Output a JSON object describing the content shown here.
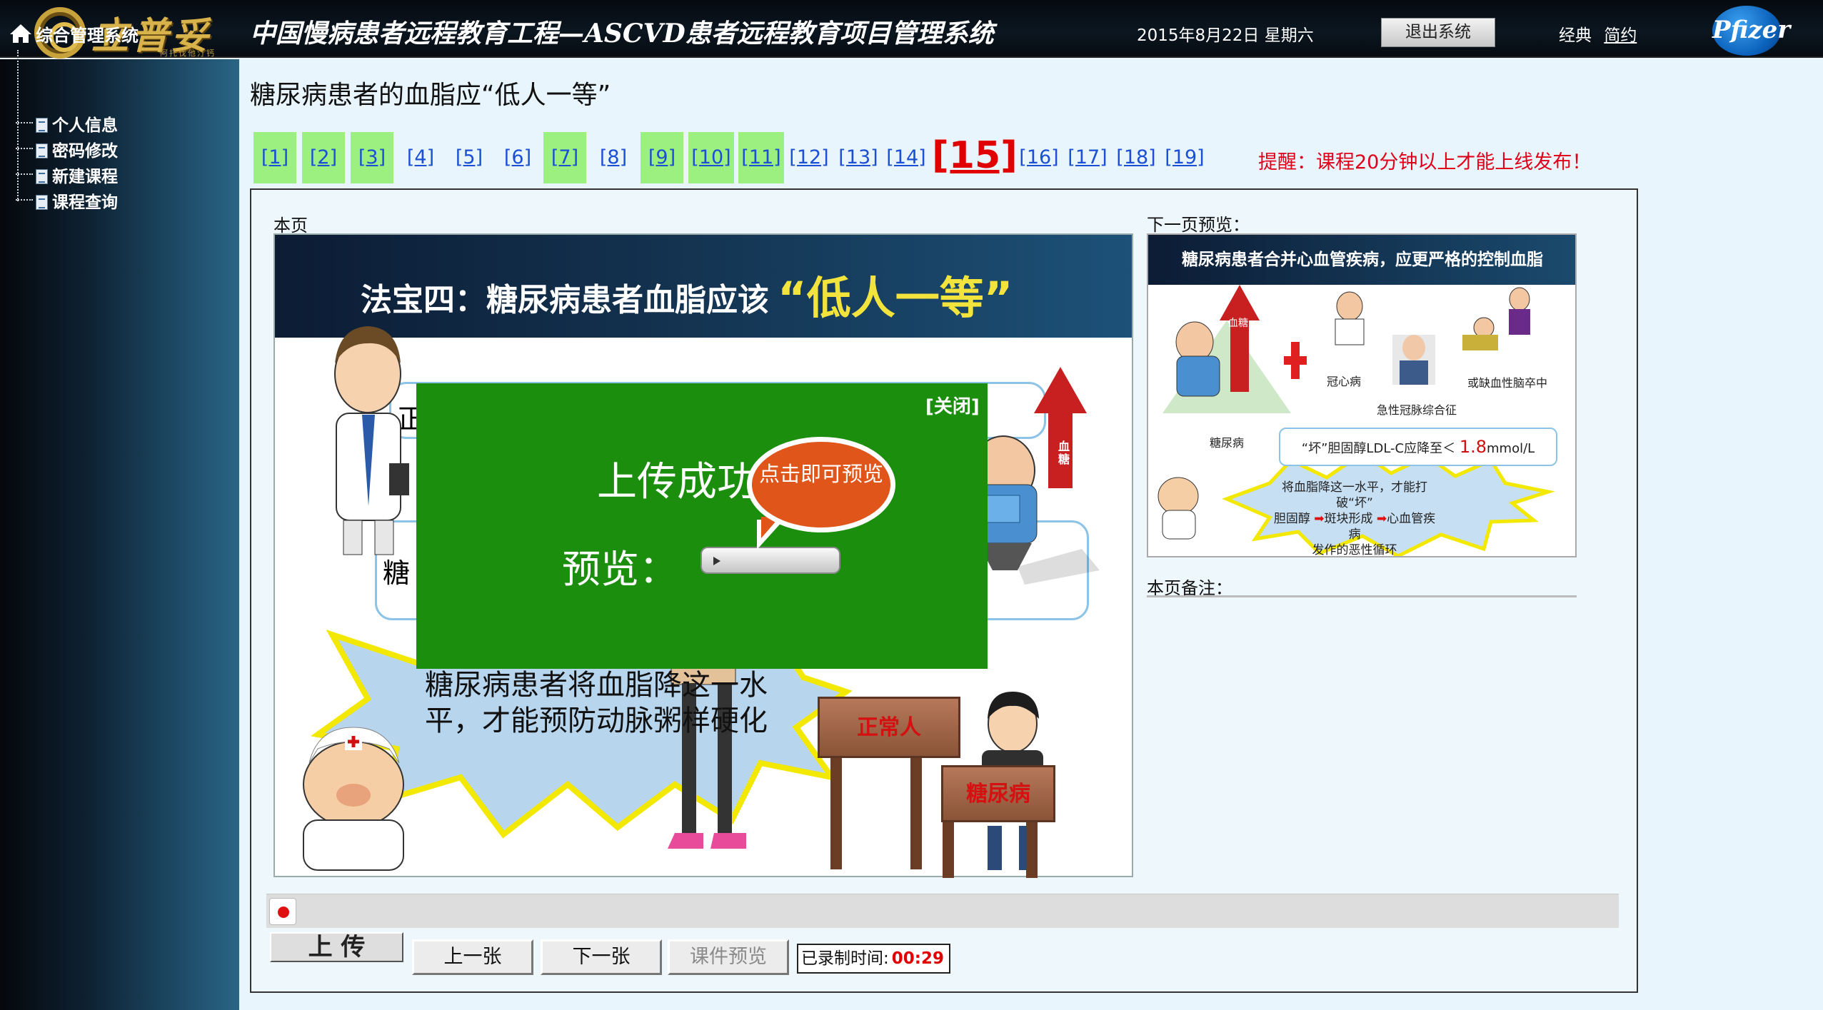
{
  "header": {
    "logo": {
      "brand": "立普妥",
      "tagline": "阿托伐他汀钙"
    },
    "system_title": "中国慢病患者远程教育工程—ASCVD患者远程教育项目管理系统",
    "date": "2015年8月22日  星期六",
    "logout_label": "退出系统",
    "theme_classic": "经典",
    "theme_simple": "简约",
    "pfizer_logo": "Pfizer"
  },
  "sidebar": {
    "root": "综合管理系统",
    "items": [
      {
        "label": "个人信息"
      },
      {
        "label": "密码修改"
      },
      {
        "label": "新建课程"
      },
      {
        "label": "课程查询"
      }
    ]
  },
  "page": {
    "title": "糖尿病患者的血脂应“低人一等”",
    "reminder": "提醒：课程20分钟以上才能上线发布！",
    "pages": [
      {
        "label": "[1]",
        "recorded": true
      },
      {
        "label": "[2]",
        "recorded": true
      },
      {
        "label": "[3]",
        "recorded": true
      },
      {
        "label": "[4]",
        "recorded": false
      },
      {
        "label": "[5]",
        "recorded": false
      },
      {
        "label": "[6]",
        "recorded": false
      },
      {
        "label": "[7]",
        "recorded": true
      },
      {
        "label": "[8]",
        "recorded": false
      },
      {
        "label": "[9]",
        "recorded": true
      },
      {
        "label": "[10]",
        "recorded": true
      },
      {
        "label": "[11]",
        "recorded": true
      },
      {
        "label": "[12]",
        "recorded": false
      },
      {
        "label": "[13]",
        "recorded": false
      },
      {
        "label": "[14]",
        "recorded": false
      },
      {
        "label": "[15]",
        "current": true
      },
      {
        "label": "[16]",
        "recorded": false
      },
      {
        "label": "[17]",
        "recorded": false
      },
      {
        "label": "[18]",
        "recorded": false
      },
      {
        "label": "[19]",
        "recorded": false
      }
    ],
    "current_page_label": "本页",
    "next_page_label": "下一页预览：",
    "notes_label": "本页备注："
  },
  "slide": {
    "heading": "法宝四：糖尿病患者血脂应该",
    "heading_highlight": "“低人一等”",
    "box1_text": "正",
    "box2_text": "糖",
    "star_text": "糖尿病患者将血脂降这一水平，才能预防动脉粥样硬化",
    "sign_normal": "正常人",
    "sign_diabetes": "糖尿病",
    "arrow_label": "血糖"
  },
  "upload_dialog": {
    "close_label": "[关闭]",
    "title": "上传成功",
    "preview_label": "预览：",
    "bubble_text": "点击即可预览"
  },
  "next_slide": {
    "heading": "糖尿病患者合并心血管疾病，应更严格的控制血脂",
    "arrow_label": "血糖",
    "label_chd": "冠心病",
    "label_acs": "急性冠脉综合征",
    "label_stroke": "或缺血性脑卒中",
    "label_diabetes": "糖尿病",
    "box_text": "“坏”胆固醇LDL-C应降至＜",
    "box_value": "1.8",
    "box_unit": "mmol/L",
    "star_line1": "将血脂降这一水平，才能打破“坏”",
    "star_line2a": "胆固醇",
    "star_line2b": "斑块形成",
    "star_line2c": "心血管疾病",
    "star_line3": "发作的恶性循环"
  },
  "controls": {
    "upload": "上 传",
    "prev": "上一张",
    "next": "下一张",
    "preview": "课件预览",
    "timer_label": "已录制时间:",
    "timer_value": "00:29"
  },
  "colors": {
    "header_bg": "#0b1620",
    "recorded_page_bg": "#9cf07f",
    "current_page": "#e00000",
    "dialog_bg": "#1b8e0e",
    "bubble": "#e0551a"
  }
}
